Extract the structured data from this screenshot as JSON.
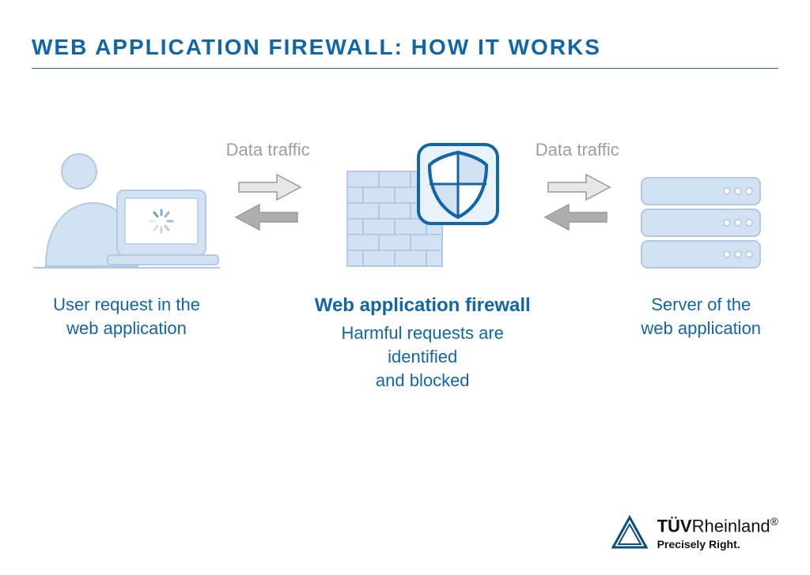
{
  "title": "WEB APPLICATION FIREWALL: HOW IT WORKS",
  "traffic_left_label": "Data traffic",
  "traffic_right_label": "Data traffic",
  "user": {
    "caption_line1": "User request in the",
    "caption_line2": "web application"
  },
  "waf": {
    "heading": "Web application firewall",
    "caption_line1": "Harmful requests are identified",
    "caption_line2": "and blocked"
  },
  "server": {
    "caption_line1": "Server of the",
    "caption_line2": "web application"
  },
  "brand": {
    "tuv": "TÜV",
    "rheinland": "Rheinland",
    "reg_mark": "®",
    "tagline": "Precisely Right."
  },
  "colors": {
    "brand_blue": "#1066a8",
    "light_fill": "#d3e2f2",
    "light_stroke": "#b1c9e4",
    "grey_text": "#9aa0a6",
    "arrow_light": "#e7e7e7",
    "arrow_dark": "#aeaeae"
  }
}
